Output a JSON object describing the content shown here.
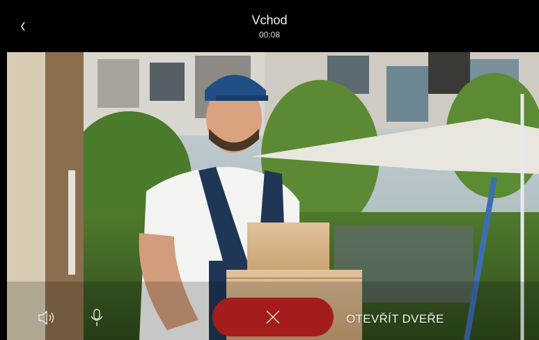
{
  "header": {
    "title": "Vchod",
    "timer": "00:08"
  },
  "controls": {
    "open_door_label": "OTEVŘÍT DVEŘE"
  },
  "icons": {
    "back": "chevron-left-icon",
    "speaker": "speaker-icon",
    "microphone": "microphone-icon",
    "hangup": "close-icon"
  },
  "colors": {
    "topbar": "#000000",
    "hangup_button": "#a41d1c",
    "text": "#ffffff"
  }
}
